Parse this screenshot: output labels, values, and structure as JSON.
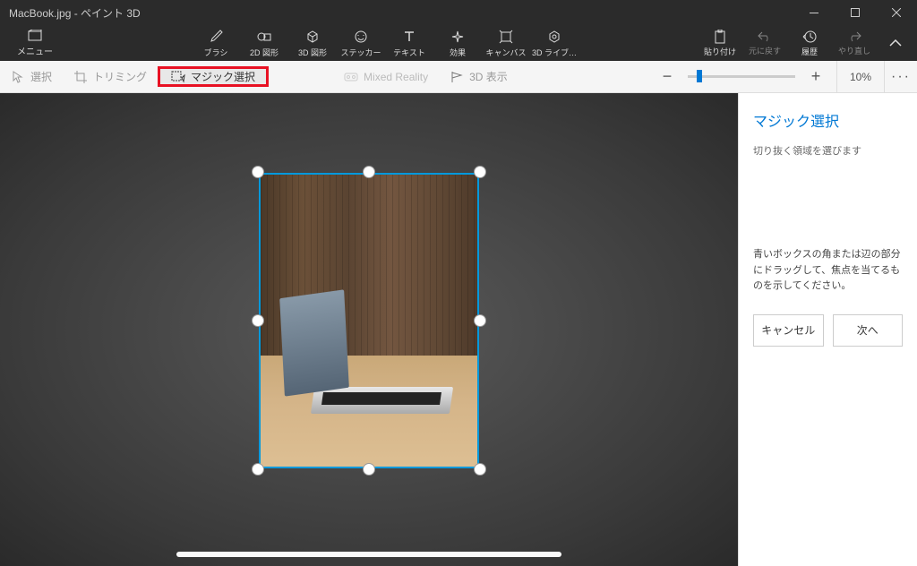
{
  "title": "MacBook.jpg - ペイント 3D",
  "menu": {
    "label": "メニュー"
  },
  "tools": {
    "brush": "ブラシ",
    "shape2d": "2D 図形",
    "shape3d": "3D 図形",
    "sticker": "ステッカー",
    "text": "テキスト",
    "effects": "効果",
    "canvas": "キャンバス",
    "library3d": "3D ライブ…"
  },
  "right_tools": {
    "paste": "貼り付け",
    "undo": "元に戻す",
    "history": "履歴",
    "redo": "やり直し"
  },
  "subbar": {
    "select": "選択",
    "trimming": "トリミング",
    "magic_select": "マジック選択",
    "mixed_reality": "Mixed Reality",
    "view3d": "3D 表示",
    "zoom_pct": "10%"
  },
  "panel": {
    "title": "マジック選択",
    "subtitle": "切り抜く領域を選びます",
    "description": "青いボックスの角または辺の部分にドラッグして、焦点を当てるものを示してください。",
    "cancel": "キャンセル",
    "next": "次へ"
  }
}
